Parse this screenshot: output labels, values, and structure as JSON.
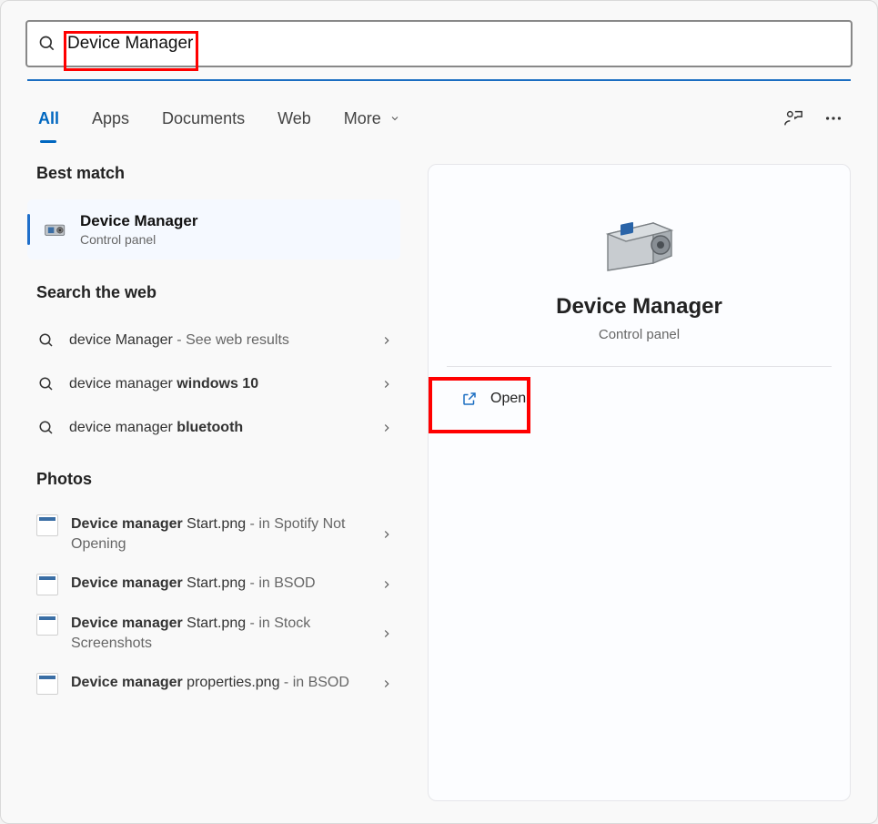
{
  "search": {
    "value": "Device Manager"
  },
  "tabs": {
    "all": "All",
    "apps": "Apps",
    "documents": "Documents",
    "web": "Web",
    "more": "More"
  },
  "sections": {
    "best_match": "Best match",
    "search_web": "Search the web",
    "photos": "Photos"
  },
  "best": {
    "title": "Device Manager",
    "subtitle": "Control panel"
  },
  "web_results": [
    {
      "prefix": "device Manager",
      "suffix": " - See web results",
      "bold_prefix": false
    },
    {
      "prefix": "device manager ",
      "bold_part": "windows 10"
    },
    {
      "prefix": "device manager ",
      "bold_part": "bluetooth"
    }
  ],
  "photos": [
    {
      "bold": "Device manager",
      "rest": " Start.png",
      "loc": " - in Spotify Not Opening"
    },
    {
      "bold": "Device manager",
      "rest": " Start.png",
      "loc": " - in BSOD"
    },
    {
      "bold": "Device manager",
      "rest": " Start.png",
      "loc": " - in Stock Screenshots"
    },
    {
      "bold": "Device manager",
      "rest": " properties.png",
      "loc": " - in BSOD"
    }
  ],
  "preview": {
    "title": "Device Manager",
    "subtitle": "Control panel",
    "open": "Open"
  }
}
